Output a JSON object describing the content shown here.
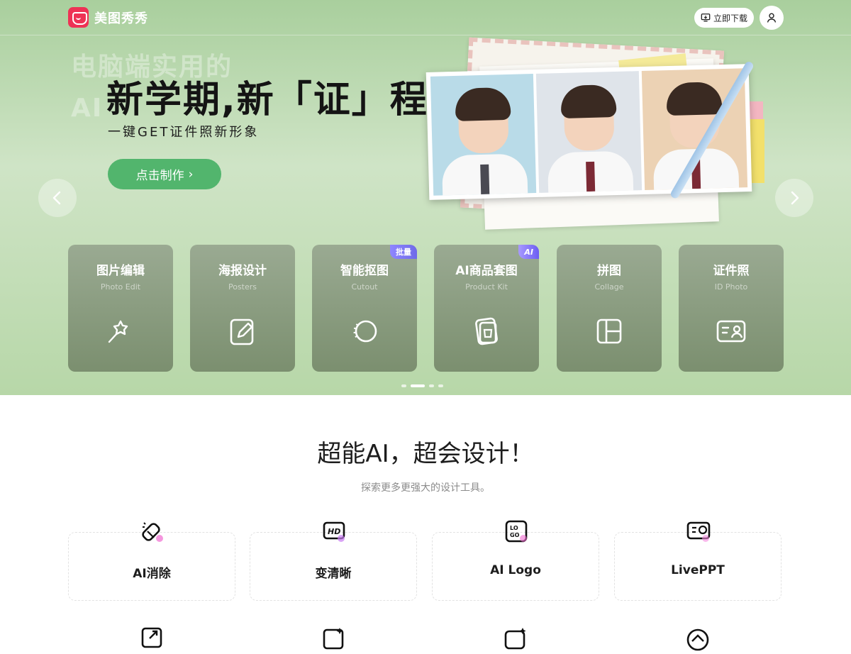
{
  "header": {
    "brand": "美图秀秀",
    "download_label": "立即下载"
  },
  "banner": {
    "ghost_lines": [
      "电脑端实用的",
      "AI"
    ],
    "title": "新学期,新「证」程",
    "subtitle": "一键GET证件照新形象",
    "cta_label": "点击制作",
    "cta_arrow": "›",
    "dots": 4,
    "active_dot": 1
  },
  "tools": [
    {
      "name": "图片编辑",
      "en": "Photo Edit",
      "icon": "magic-wand-icon",
      "badge": ""
    },
    {
      "name": "海报设计",
      "en": "Posters",
      "icon": "edit-icon",
      "badge": ""
    },
    {
      "name": "智能抠图",
      "en": "Cutout",
      "icon": "cutout-icon",
      "badge": "批量"
    },
    {
      "name": "AI商品套图",
      "en": "Product Kit",
      "icon": "product-kit-icon",
      "badge": "AI"
    },
    {
      "name": "拼图",
      "en": "Collage",
      "icon": "collage-icon",
      "badge": ""
    },
    {
      "name": "证件照",
      "en": "ID Photo",
      "icon": "id-card-icon",
      "badge": ""
    }
  ],
  "section": {
    "title": "超能AI，超会设计！",
    "subtitle": "探索更多更强大的设计工具。"
  },
  "features": [
    {
      "label": "AI消除",
      "icon": "eraser-icon"
    },
    {
      "label": "变清晰",
      "icon": "hd-icon"
    },
    {
      "label": "AI Logo",
      "icon": "logo-icon"
    },
    {
      "label": "LivePPT",
      "icon": "ppt-icon"
    }
  ],
  "colors": {
    "accent": "#52b56d",
    "brand": "#ee3255",
    "badge_purple": "#6f6ae8"
  }
}
